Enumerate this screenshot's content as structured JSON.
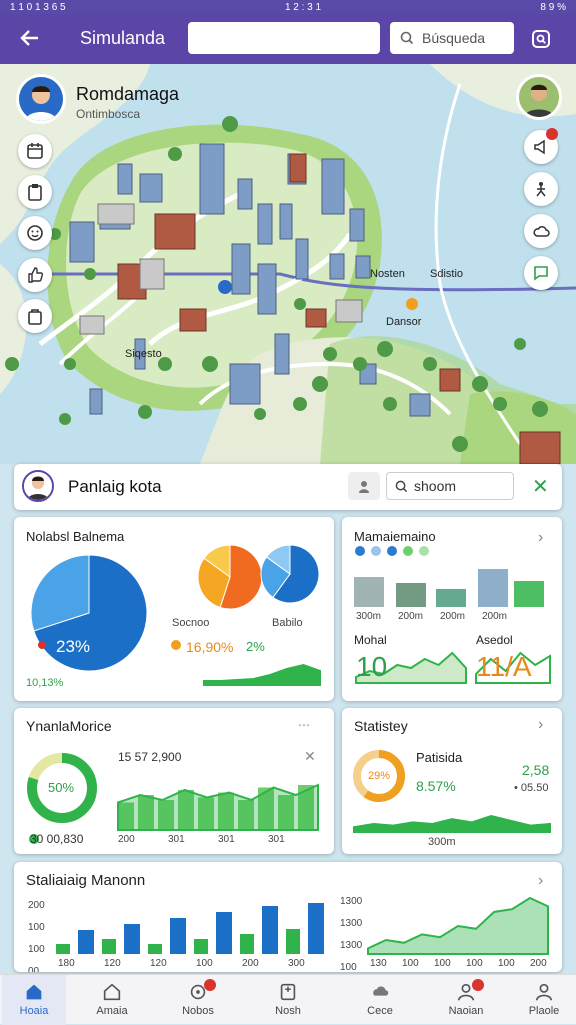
{
  "status": {
    "left": "1 1 0 1 3 6 5",
    "time": "1 2 : 3 1",
    "battery": "8 9 %"
  },
  "appbar": {
    "title": "Simulanda",
    "search_placeholder": "Búsqueda"
  },
  "profile": {
    "name": "Romdamaga",
    "subtitle": "Ontimbosca"
  },
  "map_labels": {
    "east_a": "Nosten",
    "east_b": "Sdistio",
    "pin": "Dansor",
    "south": "Siqesto"
  },
  "panel": {
    "title": "Panlaig kota",
    "search_text": "shoom",
    "close": "✕"
  },
  "card1": {
    "title": "Nolabsl Balnema",
    "pie_label": "23%",
    "foot": "10,13%",
    "mid_label": "Socnoo",
    "mid_label2": "Babilo",
    "value1": "16,90%",
    "value2": "2%",
    "pie1": [
      [
        0.7,
        "#1c6fc7"
      ],
      [
        0.3,
        "#4aa3e6"
      ]
    ],
    "pie2": [
      [
        0.55,
        "#f06a20"
      ],
      [
        0.3,
        "#f5a623"
      ],
      [
        0.15,
        "#f8c94a"
      ]
    ],
    "pie3": [
      [
        0.6,
        "#1c6fc7"
      ],
      [
        0.25,
        "#4aa3e6"
      ],
      [
        0.15,
        "#8ec9f3"
      ]
    ]
  },
  "card2": {
    "title": "Mamaiemaino",
    "bar_labels": [
      "300m",
      "200m",
      "200m",
      "200m"
    ],
    "sub1": "Mohal",
    "sub2": "Asedol",
    "big1": "10",
    "big2": "11/A",
    "dots": [
      "#2a7bd2",
      "#9cc3ee",
      "#2a7bd2",
      "#6fcf6f",
      "#a8e0a8"
    ]
  },
  "card3": {
    "title": "YnanlaMorice",
    "top_value": "15 57 2,900",
    "ring_label": "50%",
    "foot": "30 00,830",
    "x_labels": [
      "200",
      "301",
      "301",
      "301"
    ],
    "bars": [
      0.55,
      0.7,
      0.6,
      0.8,
      0.65,
      0.75,
      0.6,
      0.85,
      0.7,
      0.9
    ]
  },
  "card4": {
    "title": "Statistey",
    "ring_label": "29%",
    "sub": "Patisida",
    "pct": "8.57%",
    "right1": "2,58",
    "right2": "• 05.50",
    "foot": "300m"
  },
  "card5": {
    "title": "Staliaiaig Manonn",
    "y_labels": [
      "200",
      "100",
      "100",
      "00"
    ],
    "x_labels": [
      "180",
      "120",
      "120",
      "100",
      "200",
      "300"
    ],
    "y2_labels": [
      "1300",
      "1300",
      "1300",
      "100"
    ],
    "x2_labels": [
      "130",
      "100",
      "100",
      "100",
      "100",
      "200"
    ],
    "bars": [
      [
        0.2,
        0.4
      ],
      [
        0.3,
        0.5
      ],
      [
        0.2,
        0.6
      ],
      [
        0.3,
        0.7
      ],
      [
        0.4,
        0.8
      ],
      [
        0.5,
        0.85
      ]
    ]
  },
  "nav": [
    {
      "label": "Hoaia",
      "active": true
    },
    {
      "label": "Amaia",
      "active": false
    },
    {
      "label": "Nobos",
      "active": false
    },
    {
      "label": "Nosh",
      "active": false
    },
    {
      "label": "Cece",
      "active": false
    },
    {
      "label": "Naoian",
      "active": false
    },
    {
      "label": "Plaole",
      "active": false
    }
  ],
  "colors": {
    "accent": "#5b45a6",
    "green": "#2fb34a",
    "blue": "#1c6fc7"
  }
}
